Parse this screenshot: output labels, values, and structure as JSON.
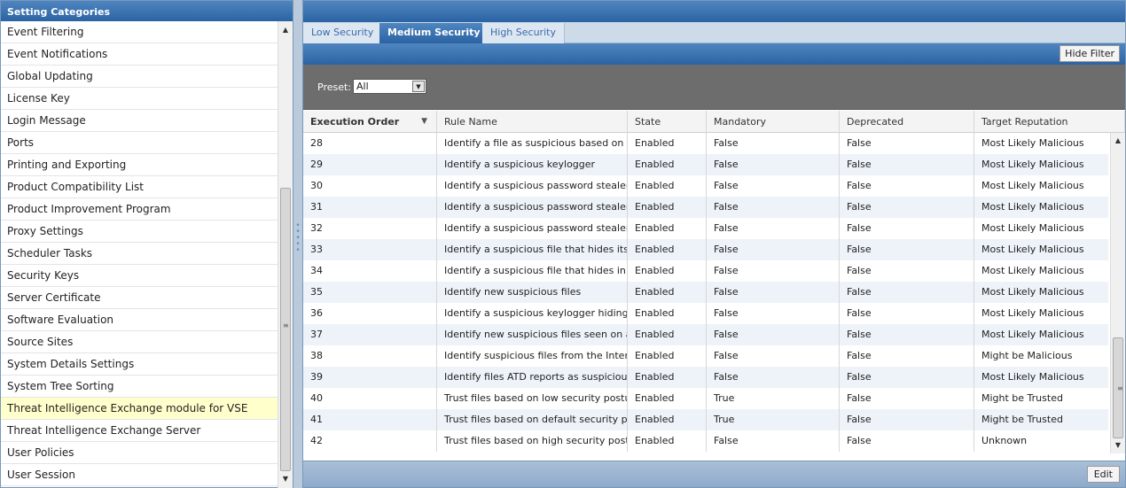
{
  "left_panel": {
    "title": "Setting Categories",
    "items": [
      {
        "label": "Event Filtering"
      },
      {
        "label": "Event Notifications"
      },
      {
        "label": "Global Updating"
      },
      {
        "label": "License Key"
      },
      {
        "label": "Login Message"
      },
      {
        "label": "Ports"
      },
      {
        "label": "Printing and Exporting"
      },
      {
        "label": "Product Compatibility List"
      },
      {
        "label": "Product Improvement Program"
      },
      {
        "label": "Proxy Settings"
      },
      {
        "label": "Scheduler Tasks"
      },
      {
        "label": "Security Keys"
      },
      {
        "label": "Server Certificate"
      },
      {
        "label": "Software Evaluation"
      },
      {
        "label": "Source Sites"
      },
      {
        "label": "System Details Settings"
      },
      {
        "label": "System Tree Sorting"
      },
      {
        "label": "Threat Intelligence Exchange module for VSE"
      },
      {
        "label": "Threat Intelligence Exchange Server"
      },
      {
        "label": "User Policies"
      },
      {
        "label": "User Session"
      }
    ],
    "selected_index": 17
  },
  "tabs": [
    {
      "label": "Low Security"
    },
    {
      "label": "Medium Security"
    },
    {
      "label": "High Security"
    }
  ],
  "active_tab": 1,
  "filter": {
    "hide_filter_label": "Hide Filter",
    "preset_label": "Preset:",
    "preset_value": "All"
  },
  "grid": {
    "columns": [
      "Execution Order",
      "Rule Name",
      "State",
      "Mandatory",
      "Deprecated",
      "Target Reputation"
    ],
    "sorted_column": "Execution Order",
    "rows": [
      [
        "28",
        "Identify a file as suspicious based on how",
        "Enabled",
        "False",
        "False",
        "Most Likely Malicious"
      ],
      [
        "29",
        "Identify a suspicious keylogger",
        "Enabled",
        "False",
        "False",
        "Most Likely Malicious"
      ],
      [
        "30",
        "Identify a suspicious password stealer (la",
        "Enabled",
        "False",
        "False",
        "Most Likely Malicious"
      ],
      [
        "31",
        "Identify a suspicious password stealer (m",
        "Enabled",
        "False",
        "False",
        "Most Likely Malicious"
      ],
      [
        "32",
        "Identify a suspicious password stealer",
        "Enabled",
        "False",
        "False",
        "Most Likely Malicious"
      ],
      [
        "33",
        "Identify a suspicious file that hides its ag",
        "Enabled",
        "False",
        "False",
        "Most Likely Malicious"
      ],
      [
        "34",
        "Identify a suspicious file that hides in a s",
        "Enabled",
        "False",
        "False",
        "Most Likely Malicious"
      ],
      [
        "35",
        "Identify new suspicious files",
        "Enabled",
        "False",
        "False",
        "Most Likely Malicious"
      ],
      [
        "36",
        "Identify a suspicious keylogger hiding as",
        "Enabled",
        "False",
        "False",
        "Most Likely Malicious"
      ],
      [
        "37",
        "Identify new suspicious files seen on a sn",
        "Enabled",
        "False",
        "False",
        "Most Likely Malicious"
      ],
      [
        "38",
        "Identify suspicious files from the Interne",
        "Enabled",
        "False",
        "False",
        "Might be Malicious"
      ],
      [
        "39",
        "Identify files ATD reports as suspicious",
        "Enabled",
        "False",
        "False",
        "Most Likely Malicious"
      ],
      [
        "40",
        "Trust files based on low security posture",
        "Enabled",
        "True",
        "False",
        "Might be Trusted"
      ],
      [
        "41",
        "Trust files based on default security post",
        "Enabled",
        "True",
        "False",
        "Might be Trusted"
      ],
      [
        "42",
        "Trust files based on high security posture",
        "Enabled",
        "False",
        "False",
        "Unknown"
      ]
    ]
  },
  "footer": {
    "edit_label": "Edit"
  }
}
